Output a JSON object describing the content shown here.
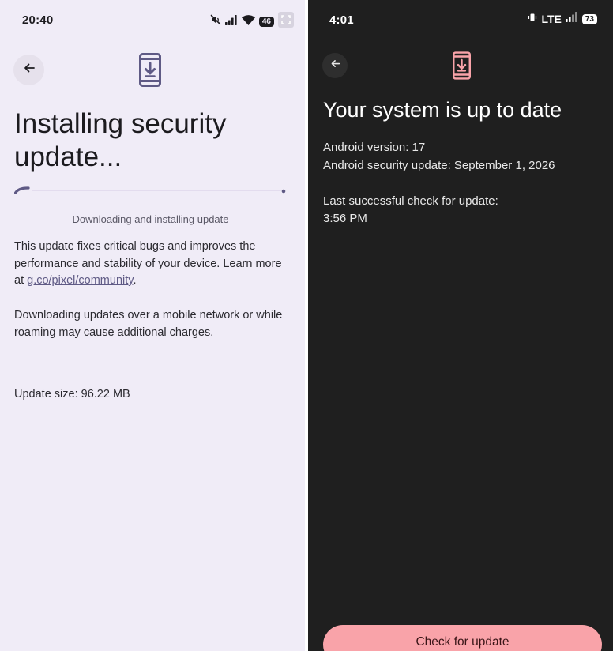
{
  "left_screen": {
    "status_bar": {
      "time": "20:40",
      "battery": "46",
      "icons": [
        "mute-icon",
        "signal-icon",
        "wifi-icon",
        "battery-icon",
        "screenshot-expand-icon"
      ]
    },
    "header": {
      "back_icon": "arrow-left-icon",
      "header_icon": "phone-download-icon"
    },
    "title": "Installing security update...",
    "progress": {
      "status": "Downloading and installing update",
      "indeterminate": true
    },
    "body": {
      "description_prefix": "This update fixes critical bugs and improves the performance and stability of your device. Learn more at ",
      "link_text": "g.co/pixel/community",
      "description_suffix": ".",
      "warning": "Downloading updates over a mobile network or while roaming may cause additional charges.",
      "update_size": "Update size: 96.22 MB"
    },
    "colors": {
      "background": "#f0ecf7",
      "accent": "#5f5a85",
      "progress_track": "#e3dcee"
    }
  },
  "right_screen": {
    "status_bar": {
      "time": "4:01",
      "network": "LTE",
      "battery": "73",
      "icons": [
        "vibrate-icon",
        "signal-icon",
        "battery-icon"
      ]
    },
    "header": {
      "back_icon": "arrow-left-icon",
      "header_icon": "phone-download-icon"
    },
    "title": "Your system is up to date",
    "info": {
      "android_version": "Android version: 17",
      "security_update": "Android security update: September 1, 2026",
      "last_check_label": "Last successful check for update:",
      "last_check_time": "3:56 PM"
    },
    "button": {
      "label": "Check for update"
    },
    "colors": {
      "background": "#1f1f1f",
      "accent": "#f9a3a9"
    }
  }
}
